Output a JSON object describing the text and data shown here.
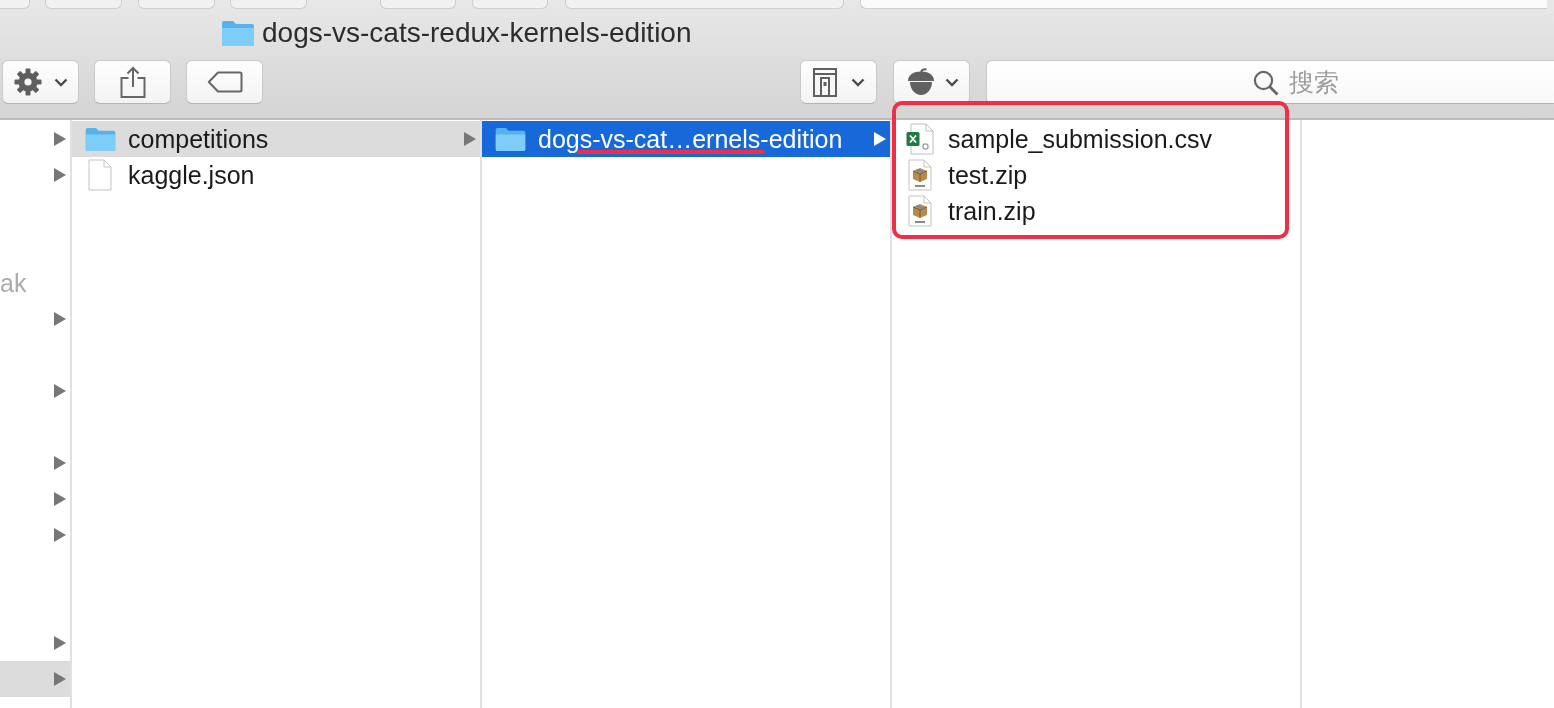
{
  "window": {
    "title": "dogs-vs-cats-redux-kernels-edition"
  },
  "search": {
    "placeholder": "搜索"
  },
  "columns": [
    {
      "focused": false,
      "rows": [
        {
          "expandable": true,
          "selected": false
        },
        {
          "expandable": true,
          "selected": false
        },
        {
          "expandable": false,
          "selected": false
        },
        {
          "expandable": false,
          "selected": false
        },
        {
          "label": "ak",
          "dimmed": true,
          "expandable": false,
          "selected": false
        },
        {
          "expandable": true,
          "selected": false
        },
        {
          "expandable": false,
          "selected": false
        },
        {
          "expandable": true,
          "selected": false
        },
        {
          "expandable": false,
          "selected": false
        },
        {
          "expandable": true,
          "selected": false
        },
        {
          "expandable": true,
          "selected": false
        },
        {
          "expandable": true,
          "selected": false
        },
        {
          "expandable": false,
          "selected": false
        },
        {
          "expandable": false,
          "selected": false
        },
        {
          "expandable": true,
          "selected": false
        },
        {
          "expandable": true,
          "selected": true
        }
      ]
    },
    {
      "focused": false,
      "rows": [
        {
          "label": "competitions",
          "kind": "folder",
          "dimmed": false,
          "expandable": true,
          "selected": true
        },
        {
          "label": "kaggle.json",
          "kind": "file",
          "dimmed": false,
          "expandable": false,
          "selected": false
        }
      ]
    },
    {
      "focused": true,
      "rows": [
        {
          "label": "dogs-vs-cat…ernels-edition",
          "kind": "folder",
          "dimmed": false,
          "expandable": true,
          "selected": true
        }
      ]
    },
    {
      "rows": [
        {
          "label": "sample_submission.csv",
          "kind": "spreadsheet",
          "dimmed": false,
          "expandable": false,
          "selected": false
        },
        {
          "label": "test.zip",
          "kind": "zip",
          "dimmed": false,
          "expandable": false,
          "selected": false
        },
        {
          "label": "train.zip",
          "kind": "zip",
          "dimmed": false,
          "expandable": false,
          "selected": false
        }
      ]
    }
  ],
  "annotations": [
    {
      "kind": "outline"
    },
    {
      "kind": "underline"
    }
  ]
}
